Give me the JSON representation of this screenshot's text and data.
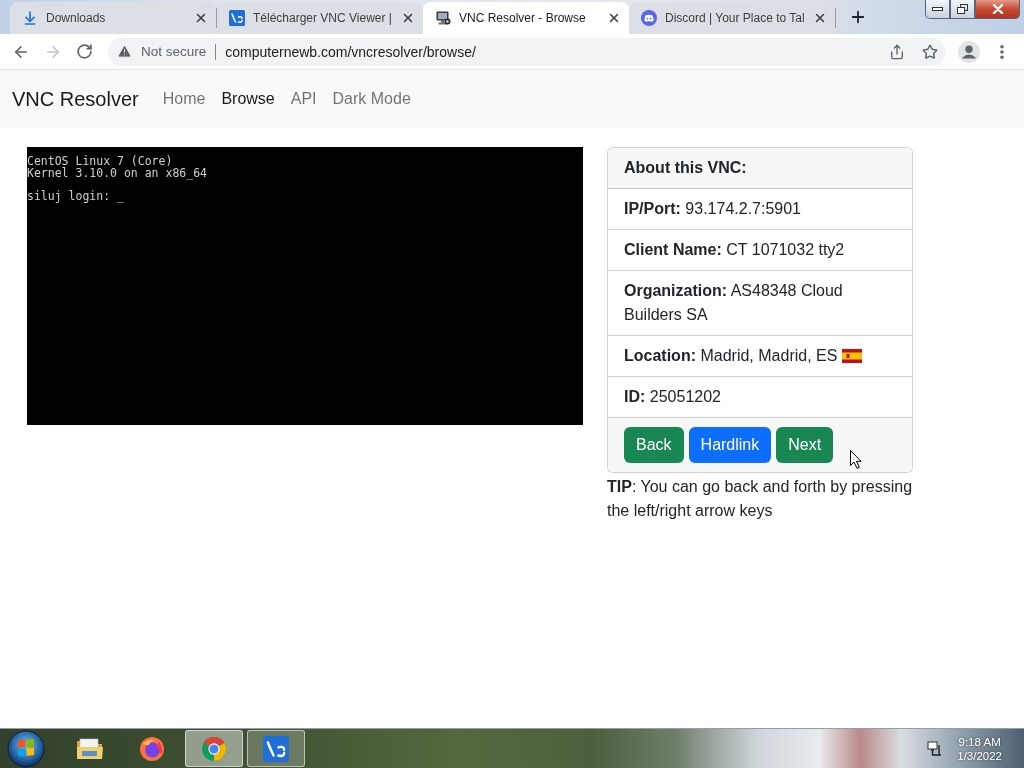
{
  "browser": {
    "tabs": [
      {
        "title": "Downloads",
        "selected": false
      },
      {
        "title": "Télécharger VNC Viewer |",
        "selected": false
      },
      {
        "title": "VNC Resolver - Browse",
        "selected": true
      },
      {
        "title": "Discord | Your Place to Tal",
        "selected": false
      }
    ],
    "address_bar": {
      "security": "Not secure",
      "url": "computernewb.com/vncresolver/browse/"
    }
  },
  "navbar": {
    "brand": "VNC Resolver",
    "links": [
      {
        "label": "Home",
        "selected": false
      },
      {
        "label": "Browse",
        "selected": true
      },
      {
        "label": "API",
        "selected": false
      },
      {
        "label": "Dark Mode",
        "selected": false
      }
    ]
  },
  "vnc_screen": {
    "banner": [
      "CentOS Linux 7 (Core)",
      "Kernel 3.10.0 on an x86_64"
    ],
    "prompt": "siluj login: _"
  },
  "card": {
    "title": "About this VNC:",
    "fields": [
      {
        "label": "IP/Port:",
        "value": "93.174.2.7:5901",
        "flag": false
      },
      {
        "label": "Client Name:",
        "value": "CT 1071032 tty2",
        "flag": false
      },
      {
        "label": "Organization:",
        "value": "AS48348 Cloud Builders SA",
        "flag": false
      },
      {
        "label": "Location:",
        "value": "Madrid, Madrid, ES",
        "flag": true
      },
      {
        "label": "ID:",
        "value": "25051202",
        "flag": false
      }
    ],
    "buttons": [
      {
        "label": "Back",
        "kind": "success"
      },
      {
        "label": "Hardlink",
        "kind": "primary"
      },
      {
        "label": "Next",
        "kind": "success"
      }
    ]
  },
  "tip": "**TIP**: You can go back and forth by pressing the left/right arrow keys",
  "taskbar": {
    "apps": [
      {
        "running": false,
        "selected": false
      },
      {
        "running": false,
        "selected": false
      },
      {
        "running": true,
        "selected": true
      },
      {
        "running": true,
        "selected": false
      }
    ],
    "clock": {
      "time": "9:18 AM",
      "date": "1/3/2022"
    }
  }
}
